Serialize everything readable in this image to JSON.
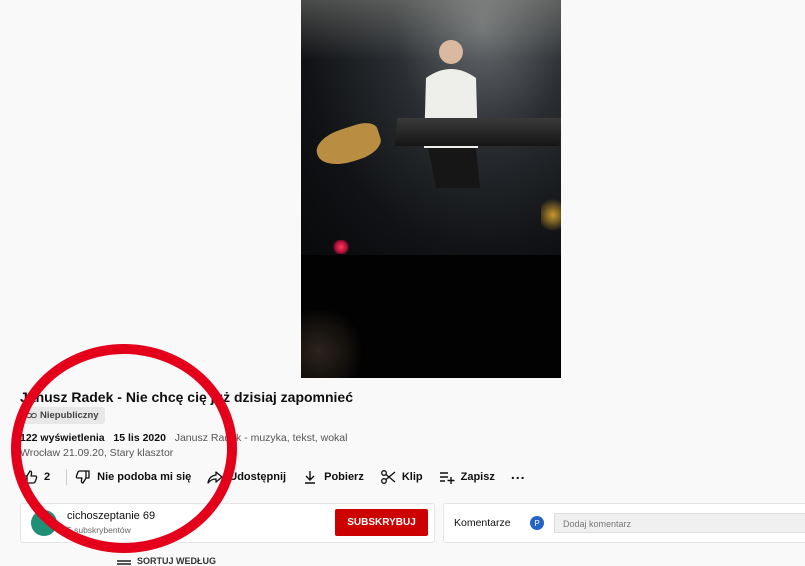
{
  "video": {
    "title": "Janusz Radek - Nie chcę cię już dzisiaj zapomnieć",
    "visibility_badge": "Niepubliczny",
    "views": "122 wyświetlenia",
    "date": "15 lis 2020",
    "description_line1": "Janusz Radek - muzyka, tekst, wokal",
    "description_line2": "Wrocław 21.09.20, Stary klasztor"
  },
  "actions": {
    "like_count": "2",
    "dislike_label": "Nie podoba mi się",
    "share_label": "Udostępnij",
    "download_label": "Pobierz",
    "clip_label": "Klip",
    "save_label": "Zapisz",
    "more_label": "..."
  },
  "channel": {
    "name": "cichoszeptanie 69",
    "subscribers": "5 subskrybentów",
    "subscribe_label": "SUBSKRYBUJ"
  },
  "comments": {
    "label": "Komentarze",
    "avatar_letter": "P",
    "placeholder": "Dodaj komentarz"
  },
  "sort": {
    "label": "SORTUJ WEDŁUG"
  },
  "colors": {
    "subscribe_red": "#cc0000",
    "annotation_circle": "#e4001b",
    "channel_avatar": "#1f8f75",
    "comment_avatar": "#2563c9"
  }
}
